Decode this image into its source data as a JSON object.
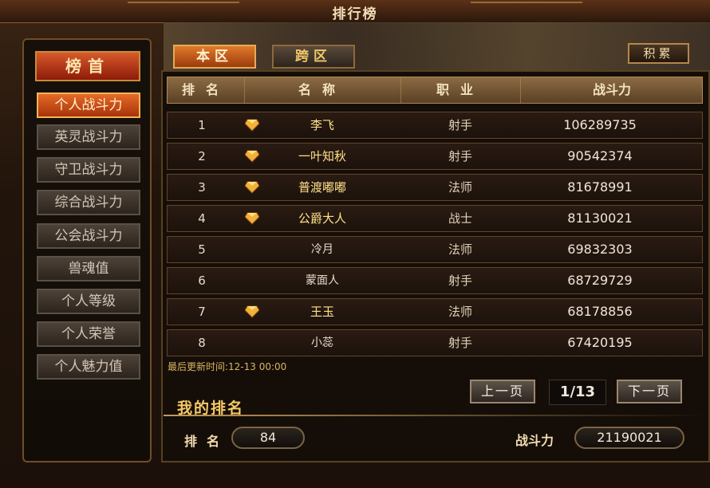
{
  "window": {
    "title": "排行榜"
  },
  "sidebar": {
    "head": "榜首",
    "items": [
      {
        "label": "个人战斗力",
        "active": true
      },
      {
        "label": "英灵战斗力",
        "active": false
      },
      {
        "label": "守卫战斗力",
        "active": false
      },
      {
        "label": "综合战斗力",
        "active": false
      },
      {
        "label": "公会战斗力",
        "active": false
      },
      {
        "label": "兽魂值",
        "active": false
      },
      {
        "label": "个人等级",
        "active": false
      },
      {
        "label": "个人荣誉",
        "active": false
      },
      {
        "label": "个人魅力值",
        "active": false
      }
    ]
  },
  "tabs": [
    {
      "label": "本区"
    },
    {
      "label": "跨区"
    }
  ],
  "accumulate_button": "积累",
  "table": {
    "headers": [
      "排名",
      "名称",
      "职业",
      "战斗力"
    ],
    "rows": [
      {
        "rank": "1",
        "name": "李飞",
        "job": "射手",
        "power": "106289735",
        "gem": true
      },
      {
        "rank": "2",
        "name": "一叶知秋",
        "job": "射手",
        "power": "90542374",
        "gem": true
      },
      {
        "rank": "3",
        "name": "普渡嘟嘟",
        "job": "法师",
        "power": "81678991",
        "gem": true
      },
      {
        "rank": "4",
        "name": "公爵大人",
        "job": "战士",
        "power": "81130021",
        "gem": true
      },
      {
        "rank": "5",
        "name": "冷月",
        "job": "法师",
        "power": "69832303",
        "gem": false
      },
      {
        "rank": "6",
        "name": "蒙面人",
        "job": "射手",
        "power": "68729729",
        "gem": false
      },
      {
        "rank": "7",
        "name": "王玉",
        "job": "法师",
        "power": "68178856",
        "gem": true
      },
      {
        "rank": "8",
        "name": "小蕊",
        "job": "射手",
        "power": "67420195",
        "gem": false
      }
    ]
  },
  "update": {
    "label": "最后更新时间:",
    "time": "12-13 00:00"
  },
  "pager": {
    "prev": "上一页",
    "page": "1/13",
    "next": "下一页"
  },
  "my_rank": {
    "title": "我的排名",
    "rank_label": "排名",
    "rank_value": "84",
    "power_label": "战斗力",
    "power_value": "21190021"
  },
  "icons": {
    "gem": "gem-icon"
  }
}
